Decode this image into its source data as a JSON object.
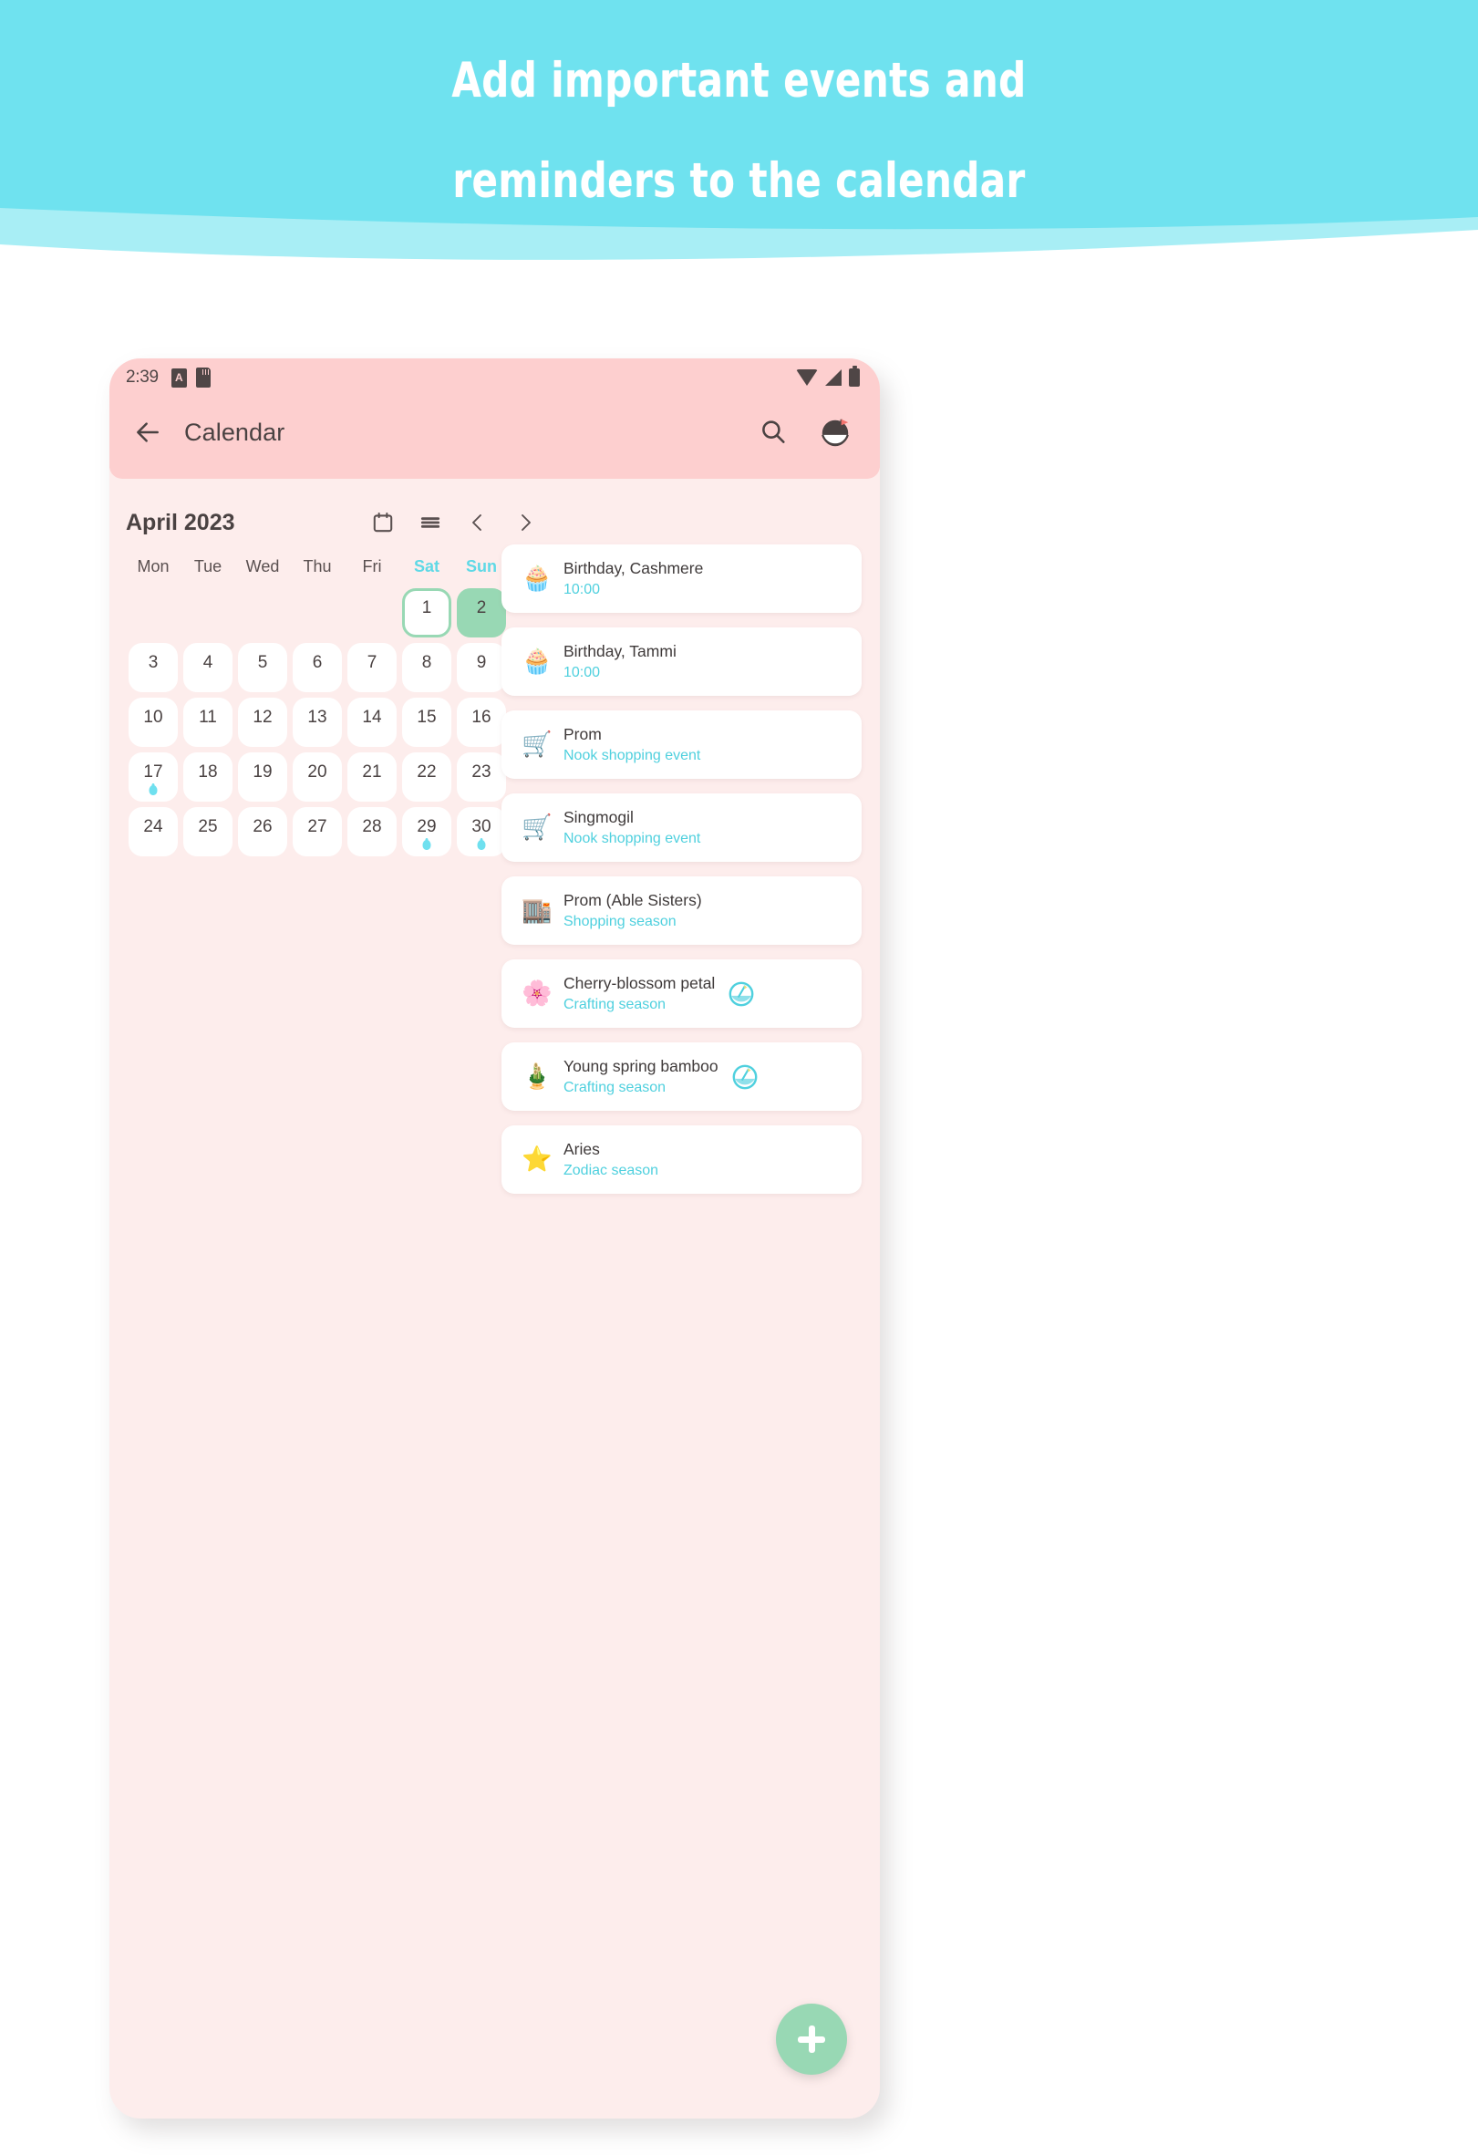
{
  "banner": {
    "line1": "Add important events and",
    "line2": "reminders to the calendar",
    "bg_color": "#6FE2EF",
    "wave_color": "#A8EEF5",
    "text_color": "#FFFFFF"
  },
  "colors": {
    "appbar_pink": "#FDCFCF",
    "screen_pink": "#FDEDEC",
    "accent_cyan": "#4FD0DE",
    "accent_green": "#98D8B4",
    "card_white": "#FFFFFF",
    "text_dark": "#4A4242"
  },
  "statusbar": {
    "time": "2:39",
    "left_icons": [
      "cast-icon",
      "sdcard-icon"
    ],
    "right_icons": [
      "wifi-icon",
      "signal-icon",
      "battery-icon"
    ]
  },
  "appbar": {
    "back_icon": "back-arrow-icon",
    "title": "Calendar",
    "search_icon": "search-icon",
    "island_icon": "island-profile-icon"
  },
  "calendar": {
    "month_label": "April 2023",
    "controls": [
      {
        "name": "calendar-view-icon",
        "label": "calendar-view"
      },
      {
        "name": "list-view-icon",
        "label": "list-view"
      },
      {
        "name": "prev-month-icon",
        "label": "‹"
      },
      {
        "name": "next-month-icon",
        "label": "›"
      }
    ],
    "weekdays": [
      {
        "label": "Mon",
        "weekend": false
      },
      {
        "label": "Tue",
        "weekend": false
      },
      {
        "label": "Wed",
        "weekend": false
      },
      {
        "label": "Thu",
        "weekend": false
      },
      {
        "label": "Fri",
        "weekend": false
      },
      {
        "label": "Sat",
        "weekend": true
      },
      {
        "label": "Sun",
        "weekend": true
      }
    ],
    "leading_blanks": 5,
    "days": [
      {
        "num": "1",
        "today": true,
        "selected": false,
        "dot": false
      },
      {
        "num": "2",
        "today": false,
        "selected": true,
        "dot": false
      },
      {
        "num": "3",
        "today": false,
        "selected": false,
        "dot": false
      },
      {
        "num": "4",
        "today": false,
        "selected": false,
        "dot": false
      },
      {
        "num": "5",
        "today": false,
        "selected": false,
        "dot": false
      },
      {
        "num": "6",
        "today": false,
        "selected": false,
        "dot": false
      },
      {
        "num": "7",
        "today": false,
        "selected": false,
        "dot": false
      },
      {
        "num": "8",
        "today": false,
        "selected": false,
        "dot": false
      },
      {
        "num": "9",
        "today": false,
        "selected": false,
        "dot": false
      },
      {
        "num": "10",
        "today": false,
        "selected": false,
        "dot": false
      },
      {
        "num": "11",
        "today": false,
        "selected": false,
        "dot": false
      },
      {
        "num": "12",
        "today": false,
        "selected": false,
        "dot": false
      },
      {
        "num": "13",
        "today": false,
        "selected": false,
        "dot": false
      },
      {
        "num": "14",
        "today": false,
        "selected": false,
        "dot": false
      },
      {
        "num": "15",
        "today": false,
        "selected": false,
        "dot": false
      },
      {
        "num": "16",
        "today": false,
        "selected": false,
        "dot": false
      },
      {
        "num": "17",
        "today": false,
        "selected": false,
        "dot": true
      },
      {
        "num": "18",
        "today": false,
        "selected": false,
        "dot": false
      },
      {
        "num": "19",
        "today": false,
        "selected": false,
        "dot": false
      },
      {
        "num": "20",
        "today": false,
        "selected": false,
        "dot": false
      },
      {
        "num": "21",
        "today": false,
        "selected": false,
        "dot": false
      },
      {
        "num": "22",
        "today": false,
        "selected": false,
        "dot": false
      },
      {
        "num": "23",
        "today": false,
        "selected": false,
        "dot": false
      },
      {
        "num": "24",
        "today": false,
        "selected": false,
        "dot": false
      },
      {
        "num": "25",
        "today": false,
        "selected": false,
        "dot": false
      },
      {
        "num": "26",
        "today": false,
        "selected": false,
        "dot": false
      },
      {
        "num": "27",
        "today": false,
        "selected": false,
        "dot": false
      },
      {
        "num": "28",
        "today": false,
        "selected": false,
        "dot": false
      },
      {
        "num": "29",
        "today": false,
        "selected": false,
        "dot": true
      },
      {
        "num": "30",
        "today": false,
        "selected": false,
        "dot": true
      }
    ]
  },
  "events": [
    {
      "icon": "cupcake-icon",
      "glyph": "🧁",
      "title": "Birthday, Cashmere",
      "subtitle": "10:00",
      "badge": false
    },
    {
      "icon": "cupcake-icon",
      "glyph": "🧁",
      "title": "Birthday, Tammi",
      "subtitle": "10:00",
      "badge": false
    },
    {
      "icon": "shopping-cart-icon",
      "glyph": "🛒",
      "title": "Prom",
      "subtitle": "Nook shopping event",
      "badge": false
    },
    {
      "icon": "shopping-cart-icon",
      "glyph": "🛒",
      "title": "Singmogil",
      "subtitle": "Nook shopping event",
      "badge": false
    },
    {
      "icon": "shop-building-icon",
      "glyph": "🏬",
      "title": "Prom (Able Sisters)",
      "subtitle": "Shopping season",
      "badge": false
    },
    {
      "icon": "cherry-petal-icon",
      "glyph": "🌸",
      "title": "Cherry-blossom petal",
      "subtitle": "Crafting season",
      "badge": true
    },
    {
      "icon": "bamboo-icon",
      "glyph": "🎍",
      "title": "Young spring bamboo",
      "subtitle": "Crafting season",
      "badge": true
    },
    {
      "icon": "star-icon",
      "glyph": "⭐",
      "title": "Aries",
      "subtitle": "Zodiac season",
      "badge": false
    }
  ],
  "fab": {
    "icon": "plus-icon",
    "label": "+"
  }
}
